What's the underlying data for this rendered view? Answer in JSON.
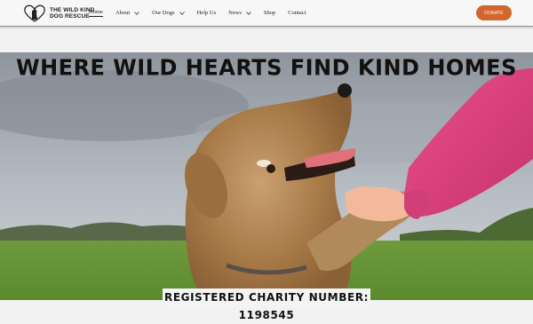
{
  "logo": {
    "line1": "THE WILD KIND",
    "line2": "DOG RESCUE",
    "icon": "dog-heart-logo-icon"
  },
  "nav": [
    {
      "label": "Home",
      "has_dropdown": false,
      "active": true
    },
    {
      "label": "About",
      "has_dropdown": true
    },
    {
      "label": "Our Dogs",
      "has_dropdown": true
    },
    {
      "label": "Help Us",
      "has_dropdown": false
    },
    {
      "label": "News",
      "has_dropdown": true
    },
    {
      "label": "Shop",
      "has_dropdown": false
    },
    {
      "label": "Contact",
      "has_dropdown": false
    }
  ],
  "donate_label": "DONATE",
  "hero": {
    "headline": "WHERE WILD HEARTS FIND KIND HOMES",
    "charity_text": "REGISTERED CHARITY NUMBER: 1198545"
  },
  "colors": {
    "accent": "#d2662d",
    "header_bg": "#f7f7f7",
    "sweater": "#e0407a"
  }
}
